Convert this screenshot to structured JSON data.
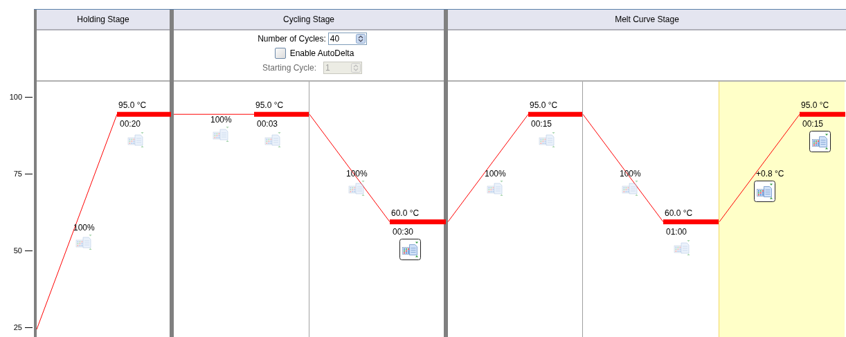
{
  "axis": {
    "ticks": [
      "100",
      "75",
      "50",
      "25"
    ]
  },
  "stages": [
    {
      "title": "Holding Stage",
      "steps": [
        {
          "ramp": "100%",
          "ramp_collect": false,
          "temperature": "95.0 °C",
          "time": "00:20",
          "hold_collect": false,
          "selected": false
        }
      ]
    },
    {
      "title": "Cycling Stage",
      "cycles": {
        "label": "Number of Cycles:",
        "value": "40"
      },
      "auto_delta": {
        "label": "Enable AutoDelta",
        "checked": false
      },
      "starting_cycle": {
        "label": "Starting Cycle:",
        "value": "1",
        "disabled": true
      },
      "steps": [
        {
          "ramp": "100%",
          "ramp_collect": false,
          "temperature": "95.0 °C",
          "time": "00:03",
          "hold_collect": false,
          "selected": false
        },
        {
          "ramp": "100%",
          "ramp_collect": false,
          "temperature": "60.0 °C",
          "time": "00:30",
          "hold_collect": true,
          "selected": false
        }
      ]
    },
    {
      "title": "Melt Curve Stage",
      "steps": [
        {
          "ramp": "100%",
          "ramp_collect": false,
          "temperature": "95.0 °C",
          "time": "00:15",
          "hold_collect": false,
          "selected": false
        },
        {
          "ramp": "100%",
          "ramp_collect": false,
          "temperature": "60.0 °C",
          "time": "01:00",
          "hold_collect": false,
          "selected": false
        },
        {
          "ramp": "+0.8 °C",
          "ramp_collect": true,
          "temperature": "95.0 °C",
          "time": "00:15",
          "hold_collect": true,
          "selected": true
        }
      ]
    }
  ]
}
